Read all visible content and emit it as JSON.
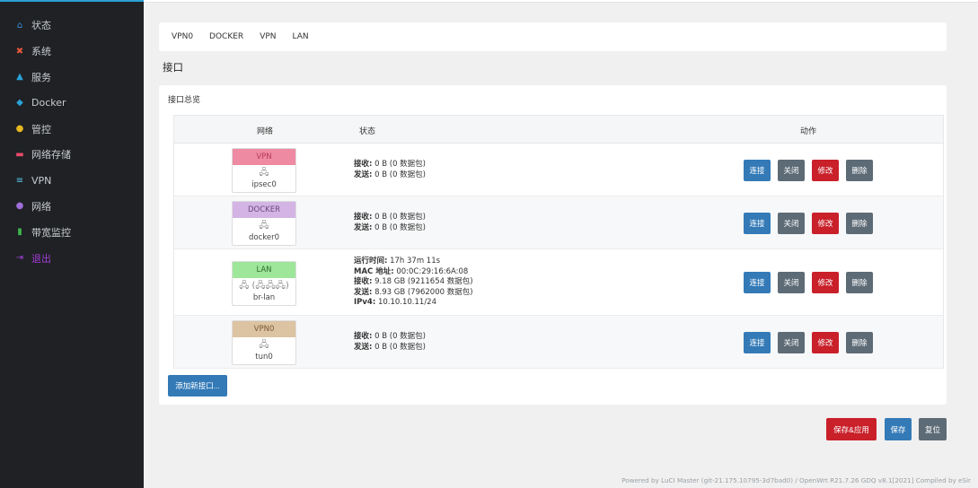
{
  "sidebar": {
    "items": [
      {
        "icon": "home-icon",
        "glyph": "⌂",
        "color": "#3d8bd9",
        "label": "状态"
      },
      {
        "icon": "tools-icon",
        "glyph": "✖",
        "color": "#e8573d",
        "label": "系统"
      },
      {
        "icon": "services-icon",
        "glyph": "▲",
        "color": "#2aa3d9",
        "label": "服务"
      },
      {
        "icon": "docker-icon",
        "glyph": "◆",
        "color": "#2aa3d9",
        "label": "Docker"
      },
      {
        "icon": "control-icon",
        "glyph": "●",
        "color": "#e6b821",
        "label": "管控"
      },
      {
        "icon": "storage-icon",
        "glyph": "▬",
        "color": "#e64a6a",
        "label": "网络存储"
      },
      {
        "icon": "vpn-icon",
        "glyph": "≡",
        "color": "#5ac4e8",
        "label": "VPN"
      },
      {
        "icon": "network-icon",
        "glyph": "●",
        "color": "#9f6ed8",
        "label": "网络"
      },
      {
        "icon": "bandwidth-icon",
        "glyph": "▮",
        "color": "#3fb54b",
        "label": "带宽监控"
      },
      {
        "icon": "logout-icon",
        "glyph": "⇥",
        "color": "#a23ed6",
        "label": "退出"
      }
    ]
  },
  "tabs": [
    "VPN0",
    "DOCKER",
    "VPN",
    "LAN"
  ],
  "page_title": "接口",
  "panel_title": "接口总览",
  "table": {
    "col_network": "网络",
    "col_status": "状态",
    "col_actions": "动作"
  },
  "rows": [
    {
      "name": "VPN",
      "color": "#ee8aa2",
      "glyph": "🖧",
      "device": "ipsec0",
      "lines": [
        {
          "k": "接收:",
          "v": " 0 B (0 数据包)"
        },
        {
          "k": "发送:",
          "v": " 0 B (0 数据包)"
        }
      ]
    },
    {
      "name": "DOCKER",
      "color": "#d3b4e4",
      "glyph": "🖧",
      "device": "docker0",
      "lines": [
        {
          "k": "接收:",
          "v": " 0 B (0 数据包)"
        },
        {
          "k": "发送:",
          "v": " 0 B (0 数据包)"
        }
      ]
    },
    {
      "name": "LAN",
      "color": "#9ee69a",
      "glyph": "🖧 (🖧🖧🖧)",
      "device": "br-lan",
      "lines": [
        {
          "k": "运行时间:",
          "v": " 17h 37m 11s"
        },
        {
          "k": "MAC 地址:",
          "v": " 00:0C:29:16:6A:08"
        },
        {
          "k": "接收:",
          "v": " 9.18 GB (9211654 数据包)"
        },
        {
          "k": "发送:",
          "v": " 8.93 GB (7962000 数据包)"
        },
        {
          "k": "IPv4:",
          "v": " 10.10.10.11/24"
        }
      ]
    },
    {
      "name": "VPN0",
      "color": "#dcc3a2",
      "glyph": "🖧",
      "device": "tun0",
      "lines": [
        {
          "k": "接收:",
          "v": " 0 B (0 数据包)"
        },
        {
          "k": "发送:",
          "v": " 0 B (0 数据包)"
        }
      ]
    }
  ],
  "actions": {
    "connect": "连接",
    "stop": "关闭",
    "edit": "修改",
    "delete": "删除"
  },
  "add_button": "添加新接口...",
  "bottom": {
    "save_apply": "保存&应用",
    "save": "保存",
    "reset": "复位"
  },
  "footer": "Powered by LuCI Master (git-21.175.10795-3d7bad0) / OpenWrt R21.7.26 GDQ v8.1[2021] Compiled by eSir"
}
